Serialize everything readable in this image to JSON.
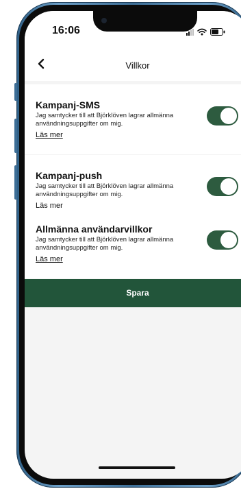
{
  "status_bar": {
    "time": "16:06",
    "icons": [
      "cellular-signal-icon",
      "wifi-icon",
      "battery-icon"
    ]
  },
  "nav": {
    "back_icon": "chevron-left-icon",
    "title": "Villkor"
  },
  "sections": [
    {
      "title": "Kampanj-SMS",
      "description": "Jag samtycker till att Björklöven lagrar allmänna användningsuppgifter om mig.",
      "link": "Läs mer",
      "enabled": true
    },
    {
      "title": "Kampanj-push",
      "description": "Jag samtycker till att Björklöven lagrar allmänna användningsuppgifter om mig.",
      "link": "Läs mer",
      "enabled": true
    },
    {
      "title": "Allmänna användarvillkor",
      "description": "Jag samtycker till att Björklöven lagrar allmänna användningsuppgifter om mig.",
      "link": "Läs mer",
      "enabled": true
    }
  ],
  "save_button": {
    "label": "Spara"
  },
  "colors": {
    "accent": "#22553a",
    "toggle_on": "#2d5b3f",
    "background": "#f4f4f4",
    "frame": "#4a7ca6"
  }
}
